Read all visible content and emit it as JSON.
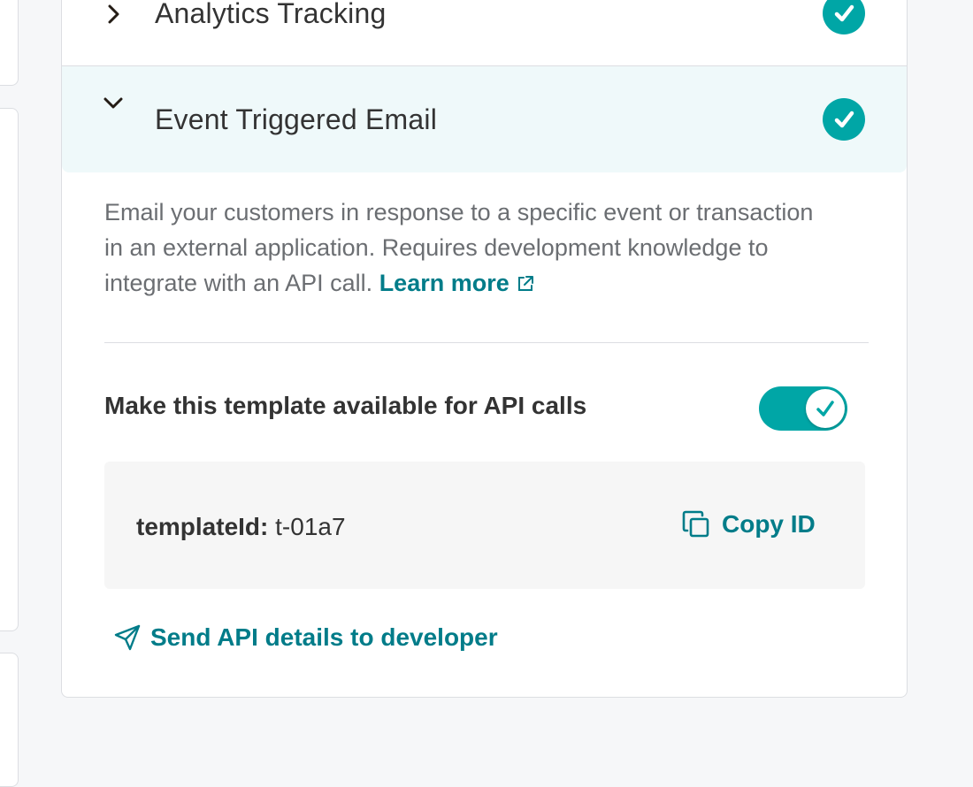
{
  "sections": {
    "analytics": {
      "title": "Analytics Tracking",
      "expanded": false,
      "enabled": true
    },
    "event_email": {
      "title": "Event Triggered Email",
      "expanded": true,
      "enabled": true
    }
  },
  "event_email_body": {
    "description": "Email your customers in response to a specific event or transaction in an external application. Requires development knowledge to integrate with an API call.",
    "learn_more_label": "Learn more",
    "api_toggle_label": "Make this template available for API calls",
    "api_toggle_on": true,
    "template_id_key": "templateId:",
    "template_id_value": "t-01a7",
    "copy_label": "Copy ID",
    "send_label": "Send API details to developer"
  },
  "colors": {
    "accent": "#007c89",
    "badge": "#00a6a6",
    "highlight_row": "#eff9fa"
  }
}
